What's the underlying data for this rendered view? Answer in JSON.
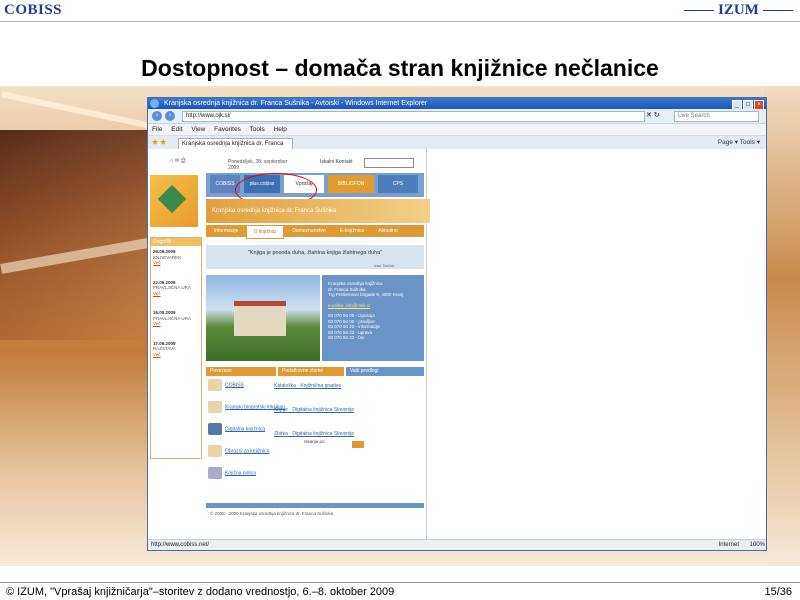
{
  "slide": {
    "logo_left": "COBISS",
    "logo_right": "IZUM",
    "title": "Dostopnost – domača stran knjižnice nečlanice",
    "footer": "© IZUM, \"Vprašaj knjižničarja\"–storitev z dodano vrednostjo, 6.–8. oktober 2009",
    "page_number": "15/36"
  },
  "browser": {
    "window_title": "Kranjska osrednja knjižnica dr. Franca Sušnika - Avtoiski - Windows Internet Explorer",
    "url": "http://www.ojk.si/",
    "search_placeholder": "Live Search",
    "menu": [
      "File",
      "Edit",
      "View",
      "Favorites",
      "Tools",
      "Help"
    ],
    "tab_label": "Kranjska osrednja knjižnica dr. Franca Sušnika - Avtoiski",
    "command_bar": "Page ▾  Tools ▾",
    "status_url": "http://www.cobiss.net/",
    "status_right": "Internet",
    "zoom": "100%"
  },
  "library": {
    "date": "Ponedeljek, 28. september 2009",
    "top_links": "Iskalni   Kontakt",
    "banners": [
      "COBISS",
      "plus.cobiss",
      "Vprašaj knjižničarja",
      "BIBLIOFON",
      "CPS"
    ],
    "header": "Kranjska osrednja knjižnica dr. Franca Sušnika",
    "tabs": [
      "Informacije",
      "O knjižnici",
      "Domoznanstvo",
      "E-knjižnica",
      "Aktualno"
    ],
    "sidebar_heading": "Dogodki",
    "sidebar_entries": [
      {
        "date": "26.09.2009",
        "text": "KNJIGVAREK",
        "more": "Več"
      },
      {
        "date": "22.09.2009",
        "text": "PRAVLJIČNA URA",
        "more": "Več"
      },
      {
        "date": "16.09.2009",
        "text": "PRAVLJIČNA URA",
        "more": "Več"
      },
      {
        "date": "17.09.2009",
        "text": "RAZSTAVA",
        "more": "Več"
      }
    ],
    "quote": "\"Knjiga je posoda duha, žlahtna knjiga žlahtnega duha\"",
    "quote_author": "Ivan Tavčar",
    "info_lines": [
      "Kranjska osrednja knjižnica",
      "dr. Franca Sušnika",
      "Trg Prešernove brigade 9, 4000 Kranj",
      "",
      "e-pošta: info@mkk.si"
    ],
    "phones": [
      "03 070 94 00 - izposoja",
      "03 070 94 00 - pravljice",
      "03 070 94 20 - informacije",
      "03 070 94 23 - uprava",
      "03 070 94 33 - fax"
    ],
    "section_headers": [
      "Povezave",
      "Podatkovne zbirke",
      "Vaši predlogi"
    ],
    "list_items": [
      "COBISS",
      "Kranjski biografski leksikon",
      "Digitalna knjižnica",
      "Obrazci za knjižnico",
      "Knjižna polica"
    ],
    "mid_links": [
      "Kataloška · Knjižnična gradiva",
      "Knjige · Digitalna knjižnica Slovenije",
      "Zbirka · Digitalna knjižnica Slovenije"
    ],
    "search_label": "Iskanje po",
    "copyright": "© 2008 - 2009 Kranjska osrednja knjižnica dr. Franca Sušnika"
  }
}
